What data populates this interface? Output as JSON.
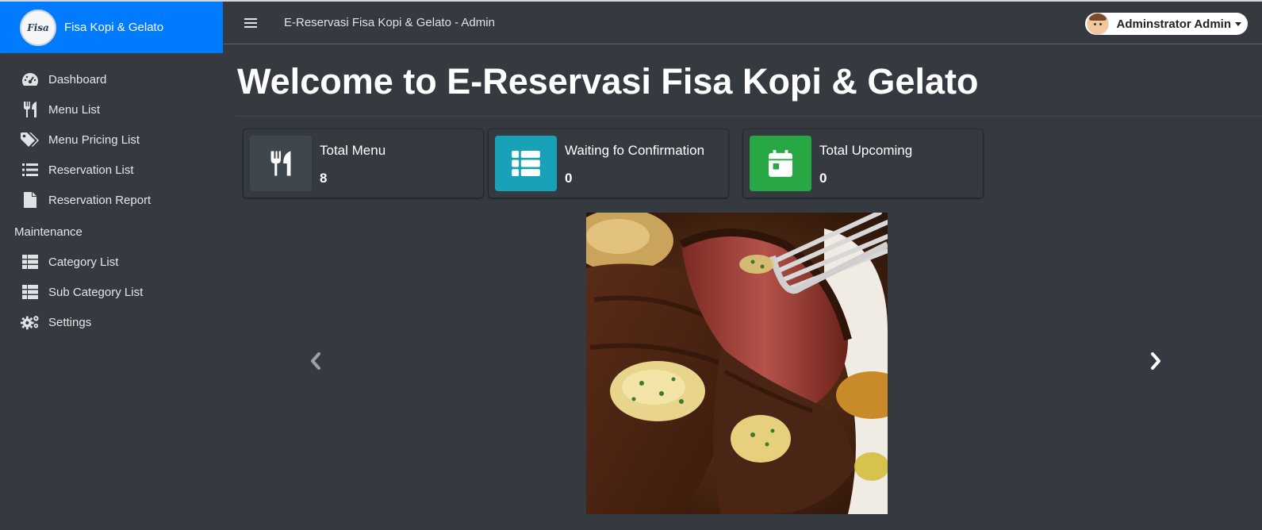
{
  "brand": {
    "name": "Fisa Kopi & Gelato",
    "logo_text": "Fisa"
  },
  "sidebar": {
    "items": [
      {
        "label": "Dashboard",
        "icon": "dashboard-icon"
      },
      {
        "label": "Menu List",
        "icon": "utensils-icon"
      },
      {
        "label": "Menu Pricing List",
        "icon": "tags-icon"
      },
      {
        "label": "Reservation List",
        "icon": "list-icon"
      },
      {
        "label": "Reservation Report",
        "icon": "file-icon"
      }
    ],
    "maintenance_header": "Maintenance",
    "maintenance_items": [
      {
        "label": "Category List",
        "icon": "table-icon"
      },
      {
        "label": "Sub Category List",
        "icon": "table-icon"
      },
      {
        "label": "Settings",
        "icon": "cogs-icon"
      }
    ]
  },
  "topbar": {
    "title": "E-Reservasi Fisa Kopi & Gelato - Admin",
    "user_name": "Adminstrator Admin"
  },
  "main": {
    "page_title": "Welcome to E-Reservasi Fisa Kopi & Gelato",
    "info_boxes": [
      {
        "label": "Total Menu",
        "value": "8",
        "icon": "utensils-icon",
        "color": "#3f474e"
      },
      {
        "label": "Waiting fo Confirmation",
        "value": "0",
        "icon": "th-list-icon",
        "color": "#17a2b8"
      },
      {
        "label": "Total Upcoming",
        "value": "0",
        "icon": "calendar-day-icon",
        "color": "#28a745"
      }
    ]
  },
  "carousel": {
    "prev_icon": "chevron-left-icon",
    "next_icon": "chevron-right-icon"
  },
  "colors": {
    "brand_bg": "#007bff",
    "body_bg": "#343a40"
  }
}
